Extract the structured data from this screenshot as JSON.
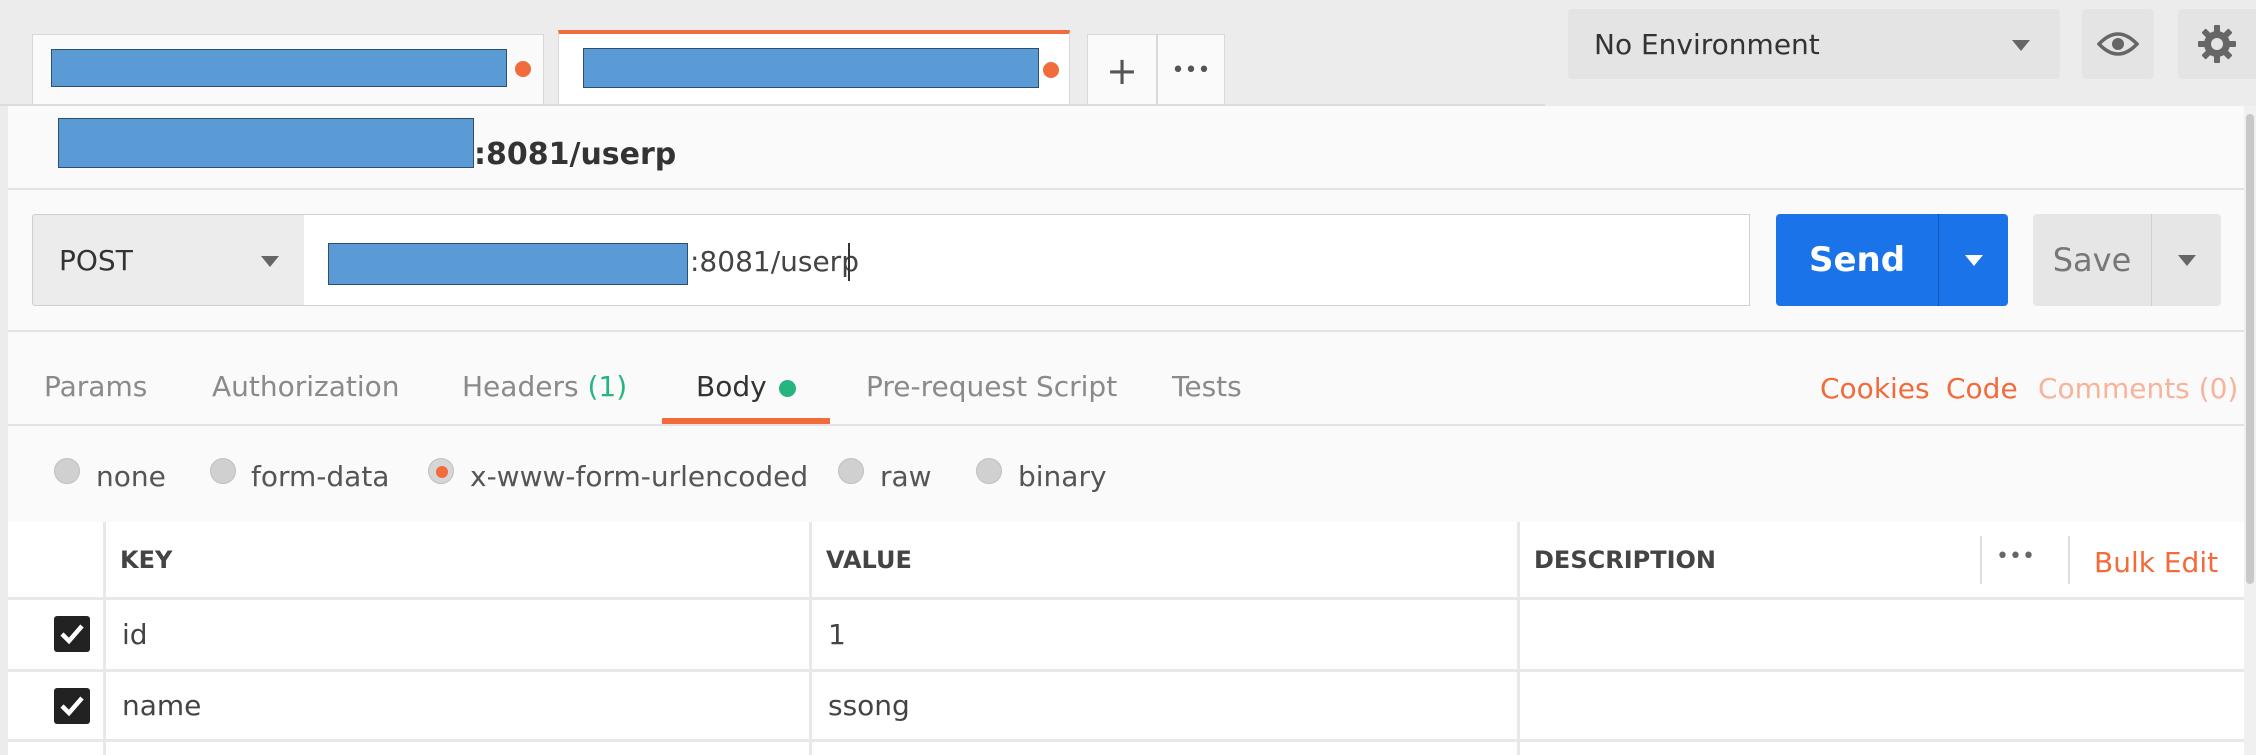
{
  "tabs": {
    "new_tab_symbol": "+",
    "more_symbol": "•••"
  },
  "environment": {
    "selected": "No Environment"
  },
  "request": {
    "title_suffix": ":8081/userp",
    "method": "POST",
    "url_suffix": ":8081/userp",
    "send_label": "Send",
    "save_label": "Save"
  },
  "request_tabs": {
    "params": "Params",
    "authorization": "Authorization",
    "headers": "Headers",
    "headers_count": "(1)",
    "body": "Body",
    "pre_request": "Pre-request Script",
    "tests": "Tests"
  },
  "links": {
    "cookies": "Cookies",
    "code": "Code",
    "comments": "Comments (0)"
  },
  "body_modes": {
    "none": "none",
    "form_data": "form-data",
    "urlencoded": "x-www-form-urlencoded",
    "raw": "raw",
    "binary": "binary",
    "selected": "x-www-form-urlencoded"
  },
  "table": {
    "headers": {
      "key": "KEY",
      "value": "VALUE",
      "description": "DESCRIPTION"
    },
    "more_symbol": "•••",
    "bulk_edit": "Bulk Edit",
    "rows": [
      {
        "key": "id",
        "value": "1",
        "description": ""
      },
      {
        "key": "name",
        "value": "ssong",
        "description": ""
      }
    ]
  },
  "colors": {
    "accent": "#f26b3a",
    "send": "#1a73e8",
    "status_green": "#26b47f"
  }
}
